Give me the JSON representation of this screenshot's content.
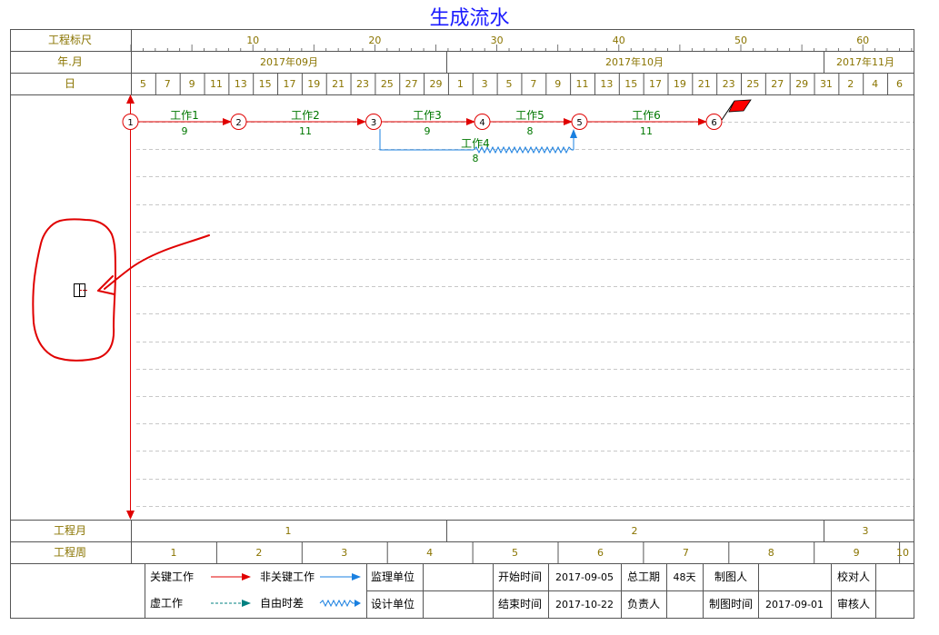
{
  "title": "生成流水",
  "header": {
    "scale_label": "工程标尺",
    "month_label": "年.月",
    "day_label": "日",
    "scale_ticks": [
      "10",
      "20",
      "30",
      "40",
      "50",
      "60"
    ],
    "months": [
      "2017年09月",
      "2017年10月",
      "2017年11月"
    ],
    "days": [
      "5",
      "7",
      "9",
      "11",
      "13",
      "15",
      "17",
      "19",
      "21",
      "23",
      "25",
      "27",
      "29",
      "1",
      "3",
      "5",
      "7",
      "9",
      "11",
      "13",
      "15",
      "17",
      "19",
      "21",
      "23",
      "25",
      "27",
      "29",
      "31",
      "2",
      "4",
      "6"
    ]
  },
  "footer": {
    "project_month_label": "工程月",
    "project_months": [
      "1",
      "2",
      "3"
    ],
    "project_week_label": "工程周",
    "project_weeks": [
      "1",
      "2",
      "3",
      "4",
      "5",
      "6",
      "7",
      "8",
      "9",
      "10"
    ]
  },
  "network": {
    "nodes": [
      "1",
      "2",
      "3",
      "4",
      "5",
      "6"
    ],
    "tasks": [
      {
        "name": "工作1",
        "duration": "9"
      },
      {
        "name": "工作2",
        "duration": "11"
      },
      {
        "name": "工作3",
        "duration": "9"
      },
      {
        "name": "工作4",
        "duration": "8"
      },
      {
        "name": "工作5",
        "duration": "8"
      },
      {
        "name": "工作6",
        "duration": "11"
      }
    ]
  },
  "legend": {
    "critical": "关键工作",
    "non_critical": "非关键工作",
    "supervisor": "监理单位",
    "dummy": "虚工作",
    "free_float": "自由时差",
    "designer": "设计单位",
    "start_label": "开始时间",
    "start_value": "2017-09-05",
    "total_label": "总工期",
    "total_value": "48天",
    "drawer_label": "制图人",
    "checker_label": "校对人",
    "end_label": "结束时间",
    "end_value": "2017-10-22",
    "owner_label": "负责人",
    "draw_time_label": "制图时间",
    "draw_time_value": "2017-09-01",
    "reviewer_label": "审核人"
  },
  "colors": {
    "critical": "#e00000",
    "non_critical": "#1a80e0",
    "dummy": "#008080",
    "text": "#8a7400",
    "task_text": "#007700",
    "title": "#1a1aff"
  }
}
